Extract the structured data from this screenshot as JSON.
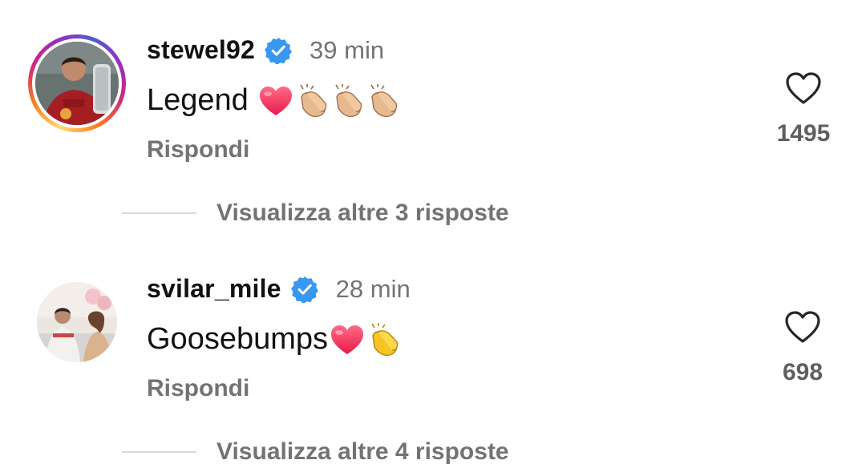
{
  "comments": [
    {
      "username": "stewel92",
      "time": "39 min",
      "text": "Legend",
      "emojis": [
        "heart-emoji",
        "clap-emoji",
        "clap-emoji",
        "clap-emoji"
      ],
      "reply_label": "Rispondi",
      "likes": "1495",
      "view_replies": "Visualizza altre 3 risposte",
      "has_story_ring": true
    },
    {
      "username": "svilar_mile",
      "time": "28 min",
      "text": "Goosebumps",
      "emojis": [
        "heart-emoji",
        "clap-emoji"
      ],
      "reply_label": "Rispondi",
      "likes": "698",
      "view_replies": "Visualizza altre 4 risposte",
      "has_story_ring": false
    }
  ],
  "colors": {
    "verified": "#3897f0",
    "secondary_text": "#737373",
    "divider": "#dbdbdb"
  }
}
